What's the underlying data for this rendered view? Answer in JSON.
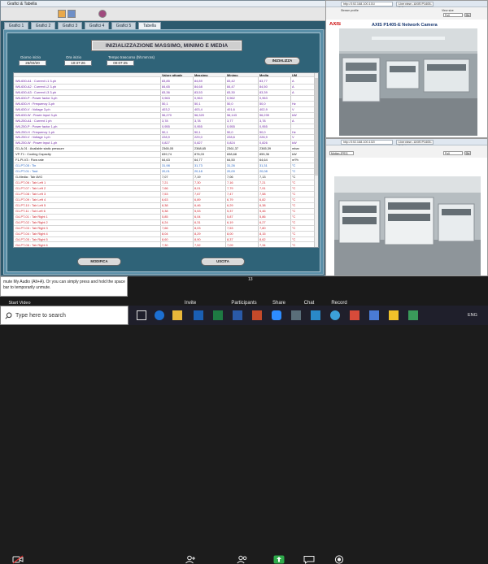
{
  "app": {
    "title": "Grafici & Tabella",
    "tabs": [
      {
        "label": "Grafici 1"
      },
      {
        "label": "Grafici 2"
      },
      {
        "label": "Grafici 3"
      },
      {
        "label": "Grafici 4"
      },
      {
        "label": "Grafici 5"
      },
      {
        "label": "Tabella"
      }
    ],
    "header_title": "INIZIALIZZAZIONE MASSIMO, MINIMO E MEDIA",
    "fields": {
      "date_label": "Giorno inizio",
      "date_value": "26/03/20",
      "time_label": "Ora inizio",
      "time_value": "10:37:26",
      "elapsed_label": "Tempo trascorso (hh:mm:ss)",
      "elapsed_value": "00:07:25"
    },
    "init_button": "INIZIALIZZA",
    "print_button": "MODIFICA",
    "exit_button": "USCITA",
    "table": {
      "headers": [
        "",
        "Valore attuale",
        "Massimo",
        "Minimo",
        "Media",
        "UM"
      ],
      "rows": [
        {
          "name": "W6-630-A1 : Current L1 3-ph",
          "v": "83,85",
          "max": "84,89",
          "min": "83,42",
          "avg": "83,77",
          "um": "A",
          "c": "#6a1fa0"
        },
        {
          "name": "W6-630-A2 : Current L2 3-ph",
          "v": "84,65",
          "max": "84,68",
          "min": "84,47",
          "avg": "84,50",
          "um": "A",
          "c": "#6a1fa0"
        },
        {
          "name": "W6-630-A3 : Current L3 3-ph",
          "v": "83,36",
          "max": "83,53",
          "min": "83,30",
          "avg": "83,39",
          "um": "A",
          "c": "#6a1fa0"
        },
        {
          "name": "W6-630-P : Power factor 3-ph",
          "v": "0,963",
          "max": "0,963",
          "min": "0,962",
          "avg": "0,963",
          "um": "",
          "c": "#6a1fa0"
        },
        {
          "name": "W6-630-H : Frequency 3-ph",
          "v": "50,1",
          "max": "50,1",
          "min": "50,0",
          "avg": "50,0",
          "um": "Hz",
          "c": "#6a1fa0"
        },
        {
          "name": "W6-630-V : Voltage 3-ph",
          "v": "403,2",
          "max": "403,4",
          "min": "401,6",
          "avg": "402,9",
          "um": "V",
          "c": "#6a1fa0"
        },
        {
          "name": "W6-630-W : Power input 3-ph",
          "v": "56,270",
          "max": "56,320",
          "min": "56,143",
          "avg": "56,239",
          "um": "kW",
          "c": "#6a1fa0"
        },
        {
          "name": "W6-250-A1 : Current 1 ph",
          "v": "3,78",
          "max": "3,78",
          "min": "3,77",
          "avg": "3,78",
          "um": "A",
          "c": "#6a1fa0"
        },
        {
          "name": "W6-250-P : Power factor 1-ph",
          "v": "0,955",
          "max": "0,955",
          "min": "0,955",
          "avg": "0,955",
          "um": "",
          "c": "#6a1fa0"
        },
        {
          "name": "W6-250-H : Frequency 1-ph",
          "v": "50,1",
          "max": "50,1",
          "min": "50,0",
          "avg": "50,0",
          "um": "Hz",
          "c": "#6a1fa0"
        },
        {
          "name": "W6-250-V : Voltage 1-ph",
          "v": "228,9",
          "max": "229,0",
          "min": "228,6",
          "avg": "228,9",
          "um": "V",
          "c": "#6a1fa0"
        },
        {
          "name": "W6-250-W : Power input 1-ph",
          "v": "0,827",
          "max": "0,827",
          "min": "0,824",
          "avg": "0,826",
          "um": "kW",
          "c": "#6a1fa0"
        },
        {
          "name": "G1-A-01 : Available static pressure",
          "v": "2365,05",
          "max": "2368,65",
          "min": "2361,37",
          "avg": "2365,39",
          "um": "mbar",
          "c": "#111111"
        },
        {
          "name": "VP-T1 : Cooling Capacity",
          "v": "839,74",
          "max": "878,03",
          "min": "838,68",
          "avg": "855,36",
          "um": "kW",
          "c": "#111111"
        },
        {
          "name": "F1-PI-V3 : Flow rate",
          "v": "64,63",
          "max": "64,77",
          "min": "64,50",
          "avg": "64,64",
          "um": "m³/h",
          "c": "#111111"
        },
        {
          "name": "G1-PT-05 : Tin",
          "v": "31,98",
          "max": "31,73",
          "min": "31,26",
          "avg": "31,31",
          "um": "°C",
          "c": "#1f5fc0"
        },
        {
          "name": "G1-PT-01 : Tout",
          "v": "20,01",
          "max": "20,18",
          "min": "20,00",
          "avg": "20,08",
          "um": "°C",
          "c": "#1f5fc0"
        },
        {
          "name": "G-Media : Tair AVG",
          "v": "7,07",
          "max": "7,19",
          "min": "7,06",
          "avg": "7,13",
          "um": "°C",
          "c": "#111111"
        },
        {
          "name": "G1-PT-06 : Tair Left 1",
          "v": "7,21",
          "max": "7,30",
          "min": "7,16",
          "avg": "7,21",
          "um": "°C",
          "c": "#d0202a"
        },
        {
          "name": "G1-PT-07 : Tair Left 2",
          "v": "7,66",
          "max": "8,01",
          "min": "7,79",
          "avg": "7,91",
          "um": "°C",
          "c": "#d0202a"
        },
        {
          "name": "G1-PT-08 : Tair Left 3",
          "v": "7,53",
          "max": "7,67",
          "min": "7,47",
          "avg": "7,58",
          "um": "°C",
          "c": "#d0202a"
        },
        {
          "name": "G1-PT-09 : Tair Left 4",
          "v": "6,63",
          "max": "6,89",
          "min": "6,79",
          "avg": "6,82",
          "um": "°C",
          "c": "#d0202a"
        },
        {
          "name": "G1-PT-10 : Tair Left 5",
          "v": "6,38",
          "max": "6,46",
          "min": "6,29",
          "avg": "6,38",
          "um": "°C",
          "c": "#d0202a"
        },
        {
          "name": "G1-PT-11 : Tair Left 6",
          "v": "5,38",
          "max": "5,53",
          "min": "5,37",
          "avg": "5,46",
          "um": "°C",
          "c": "#d0202a"
        },
        {
          "name": "G4-PT-01 : Tair Right 1",
          "v": "5,85",
          "max": "6,04",
          "min": "5,87",
          "avg": "5,86",
          "um": "°C",
          "c": "#d0202a"
        },
        {
          "name": "G4-PT-02 : Tair Right 2",
          "v": "6,24",
          "max": "6,31",
          "min": "6,19",
          "avg": "6,27",
          "um": "°C",
          "c": "#d0202a"
        },
        {
          "name": "G4-PT-03 : Tair Right 3",
          "v": "7,66",
          "max": "8,03",
          "min": "7,53",
          "avg": "7,80",
          "um": "°C",
          "c": "#d0202a"
        },
        {
          "name": "G4-PT-04 : Tair Right 4",
          "v": "8,04",
          "max": "8,29",
          "min": "8,00",
          "avg": "8,15",
          "um": "°C",
          "c": "#d0202a"
        },
        {
          "name": "G4-PT-05 : Tair Right 5",
          "v": "8,60",
          "max": "8,90",
          "min": "8,37",
          "avg": "8,62",
          "um": "°C",
          "c": "#d0202a"
        },
        {
          "name": "G4-PT-06 : Tair Right 6",
          "v": "7,30",
          "max": "7,52",
          "min": "7,09",
          "avg": "7,34",
          "um": "°C",
          "c": "#d0202a"
        }
      ]
    }
  },
  "browser_top": {
    "url": "http://192.168.100.101/",
    "tab": "Live view - AXIS P1405-E N...",
    "brand": "AXIS",
    "camera_title": "AXIS P1405-E Network Camera",
    "view_label": "View size",
    "view_value": "Full",
    "stream_label": "Stream profile",
    "stream_value": "Motion JPEG",
    "go": "Go"
  },
  "browser_bottom": {
    "url": "http://192.168.100.102/",
    "tab": "Live view - AXIS P1405-E Net...",
    "view_value": "Full",
    "stream_value": "Motion JPEG",
    "go": "Go"
  },
  "meeting": {
    "tooltip": "mute My Audio (Alt+A). Or you can simply press and hold the space bar to temporarily unmute.",
    "start_video": "Start Video",
    "invite": "Invite",
    "participants": "Participants",
    "participants_count": "13",
    "share": "Share",
    "chat": "Chat",
    "record": "Record"
  },
  "taskbar": {
    "search_placeholder": "Type here to search",
    "lang": "ENG"
  }
}
